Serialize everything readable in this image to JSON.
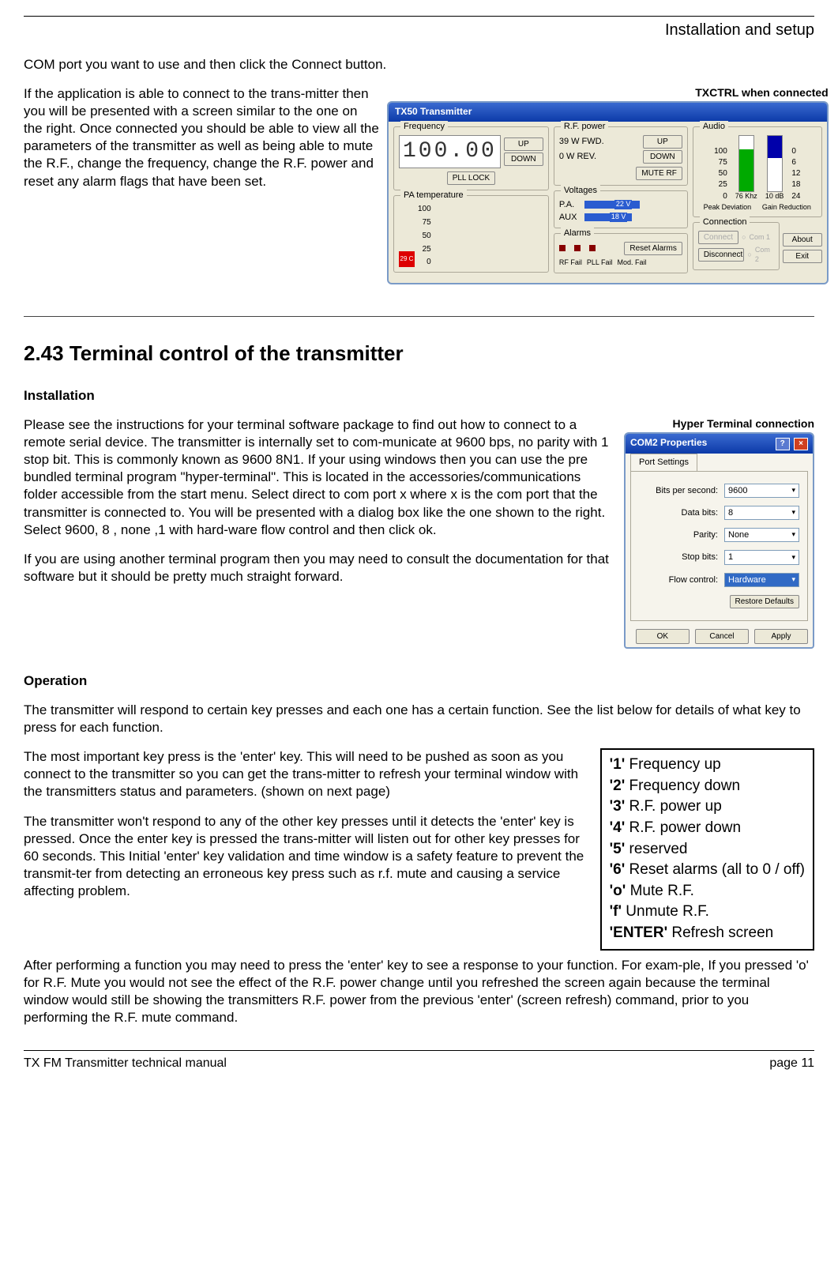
{
  "header": {
    "section": "Installation and setup"
  },
  "intro_line": "COM port you want to use and then click the Connect button.",
  "p1": "If the application is able to connect to the trans-mitter then you will be presented with a screen similar to the one on the right. Once connected you should be able to view all the parameters of the transmitter as well as being able to mute the R.F., change the frequency, change the R.F. power and reset any alarm flags that have been set.",
  "caption1": "TXCTRL when connected",
  "tx50": {
    "title": "TX50 Transmitter",
    "groups": {
      "frequency": "Frequency",
      "rf_power": "R.F. power",
      "audio": "Audio",
      "pa_temp": "PA temperature",
      "voltages": "Voltages",
      "alarms": "Alarms",
      "connection": "Connection"
    },
    "freq_display": "100.00",
    "btn_up": "UP",
    "btn_down": "DOWN",
    "pll_lock": "PLL LOCK",
    "rf_fwd": "39 W FWD.",
    "rf_rev": "0 W REV.",
    "mute_rf": "MUTE RF",
    "pa_temp_val": "29 C",
    "pa_scale": [
      "100",
      "75",
      "50",
      "25",
      "0"
    ],
    "volt_pa": "P.A.",
    "volt_pa_val": "22 V",
    "volt_aux": "AUX",
    "volt_aux_val": "18 V",
    "alarm_rf": "RF Fail",
    "alarm_pll": "PLL Fail",
    "alarm_mod": "Mod. Fail",
    "reset_alarms": "Reset Alarms",
    "audio_left_scale": [
      "100",
      "75",
      "50",
      "25",
      "0"
    ],
    "audio_right_scale": [
      "0",
      "6",
      "12",
      "18",
      "24"
    ],
    "peak_dev": "Peak Deviation",
    "peak_dev_val": "76 Khz",
    "gain_red": "Gain Reduction",
    "gain_red_val": "10 dB",
    "connect": "Connect",
    "disconnect": "Disconnect",
    "com1": "Com 1",
    "com2": "Com 2",
    "about": "About",
    "exit": "Exit"
  },
  "s243_title": "2.43  Terminal control of the transmitter",
  "installation_h": "Installation",
  "install_p1": "Please see the instructions for your terminal software package to find out how to connect to a remote serial device. The transmitter is internally set to com-municate at 9600 bps, no parity with 1 stop bit. This is commonly known as 9600 8N1. If your using windows then you can use the pre bundled terminal program \"hyper-terminal\". This is located in the accessories/communications folder accessible from the start menu. Select direct to com port x where x is the com port that the transmitter is connected to. You will be presented with a dialog box like the one shown to the right. Select 9600, 8 , none ,1 with hard-ware flow control and then click ok.",
  "install_p2": "If you are using another terminal program then you may need to consult the documentation for that software but it should be pretty much straight forward.",
  "caption2": "Hyper Terminal connection",
  "com2dlg": {
    "title": "COM2 Properties",
    "tab": "Port Settings",
    "rows": {
      "bps_l": "Bits per second:",
      "bps_v": "9600",
      "db_l": "Data bits:",
      "db_v": "8",
      "par_l": "Parity:",
      "par_v": "None",
      "sb_l": "Stop bits:",
      "sb_v": "1",
      "fc_l": "Flow control:",
      "fc_v": "Hardware"
    },
    "restore": "Restore Defaults",
    "ok": "OK",
    "cancel": "Cancel",
    "apply": "Apply"
  },
  "operation_h": "Operation",
  "op_p1": "The transmitter will respond to certain key presses and each one has a certain function. See the list below for details of what key to press for each function.",
  "op_p2": "The most important key press is the 'enter' key. This will need to be pushed as soon as you connect to the transmitter so you can get the trans-mitter to refresh your terminal window with  the transmitters status and parameters. (shown on next page)",
  "op_p3": "The transmitter won't respond to any of the other key presses until it detects the 'enter' key is pressed. Once the enter key is pressed the trans-mitter will listen out for other key presses for 60 seconds. This Initial 'enter' key validation and time window is a safety feature to prevent the transmit-ter from detecting an erroneous key press such as r.f. mute and causing a service affecting problem.",
  "op_p4": "After performing a function you may need to press the 'enter' key to see a response to your function. For exam-ple, If you pressed 'o' for R.F. Mute you would not see the effect of the R.F. power change until you refreshed the screen again because the terminal window would still be showing the transmitters R.F. power from the previous 'enter' (screen refresh) command, prior to you performing the R.F. mute command.",
  "keys": {
    "k1": "'1'",
    "d1": " Frequency up",
    "k2": "'2'",
    "d2": " Frequency down",
    "k3": "'3'",
    "d3": " R.F. power up",
    "k4": "'4'",
    "d4": " R.F. power down",
    "k5": "'5'",
    "d5": " reserved",
    "k6": "'6'",
    "d6": " Reset alarms (all to 0 / off)",
    "ko": "'o'",
    "do": " Mute R.F.",
    "kf": "'f'",
    "df": " Unmute R.F.",
    "ke": "'ENTER'",
    "de": " Refresh screen"
  },
  "footer": {
    "left": "TX FM Transmitter technical manual",
    "right": "page 11"
  }
}
